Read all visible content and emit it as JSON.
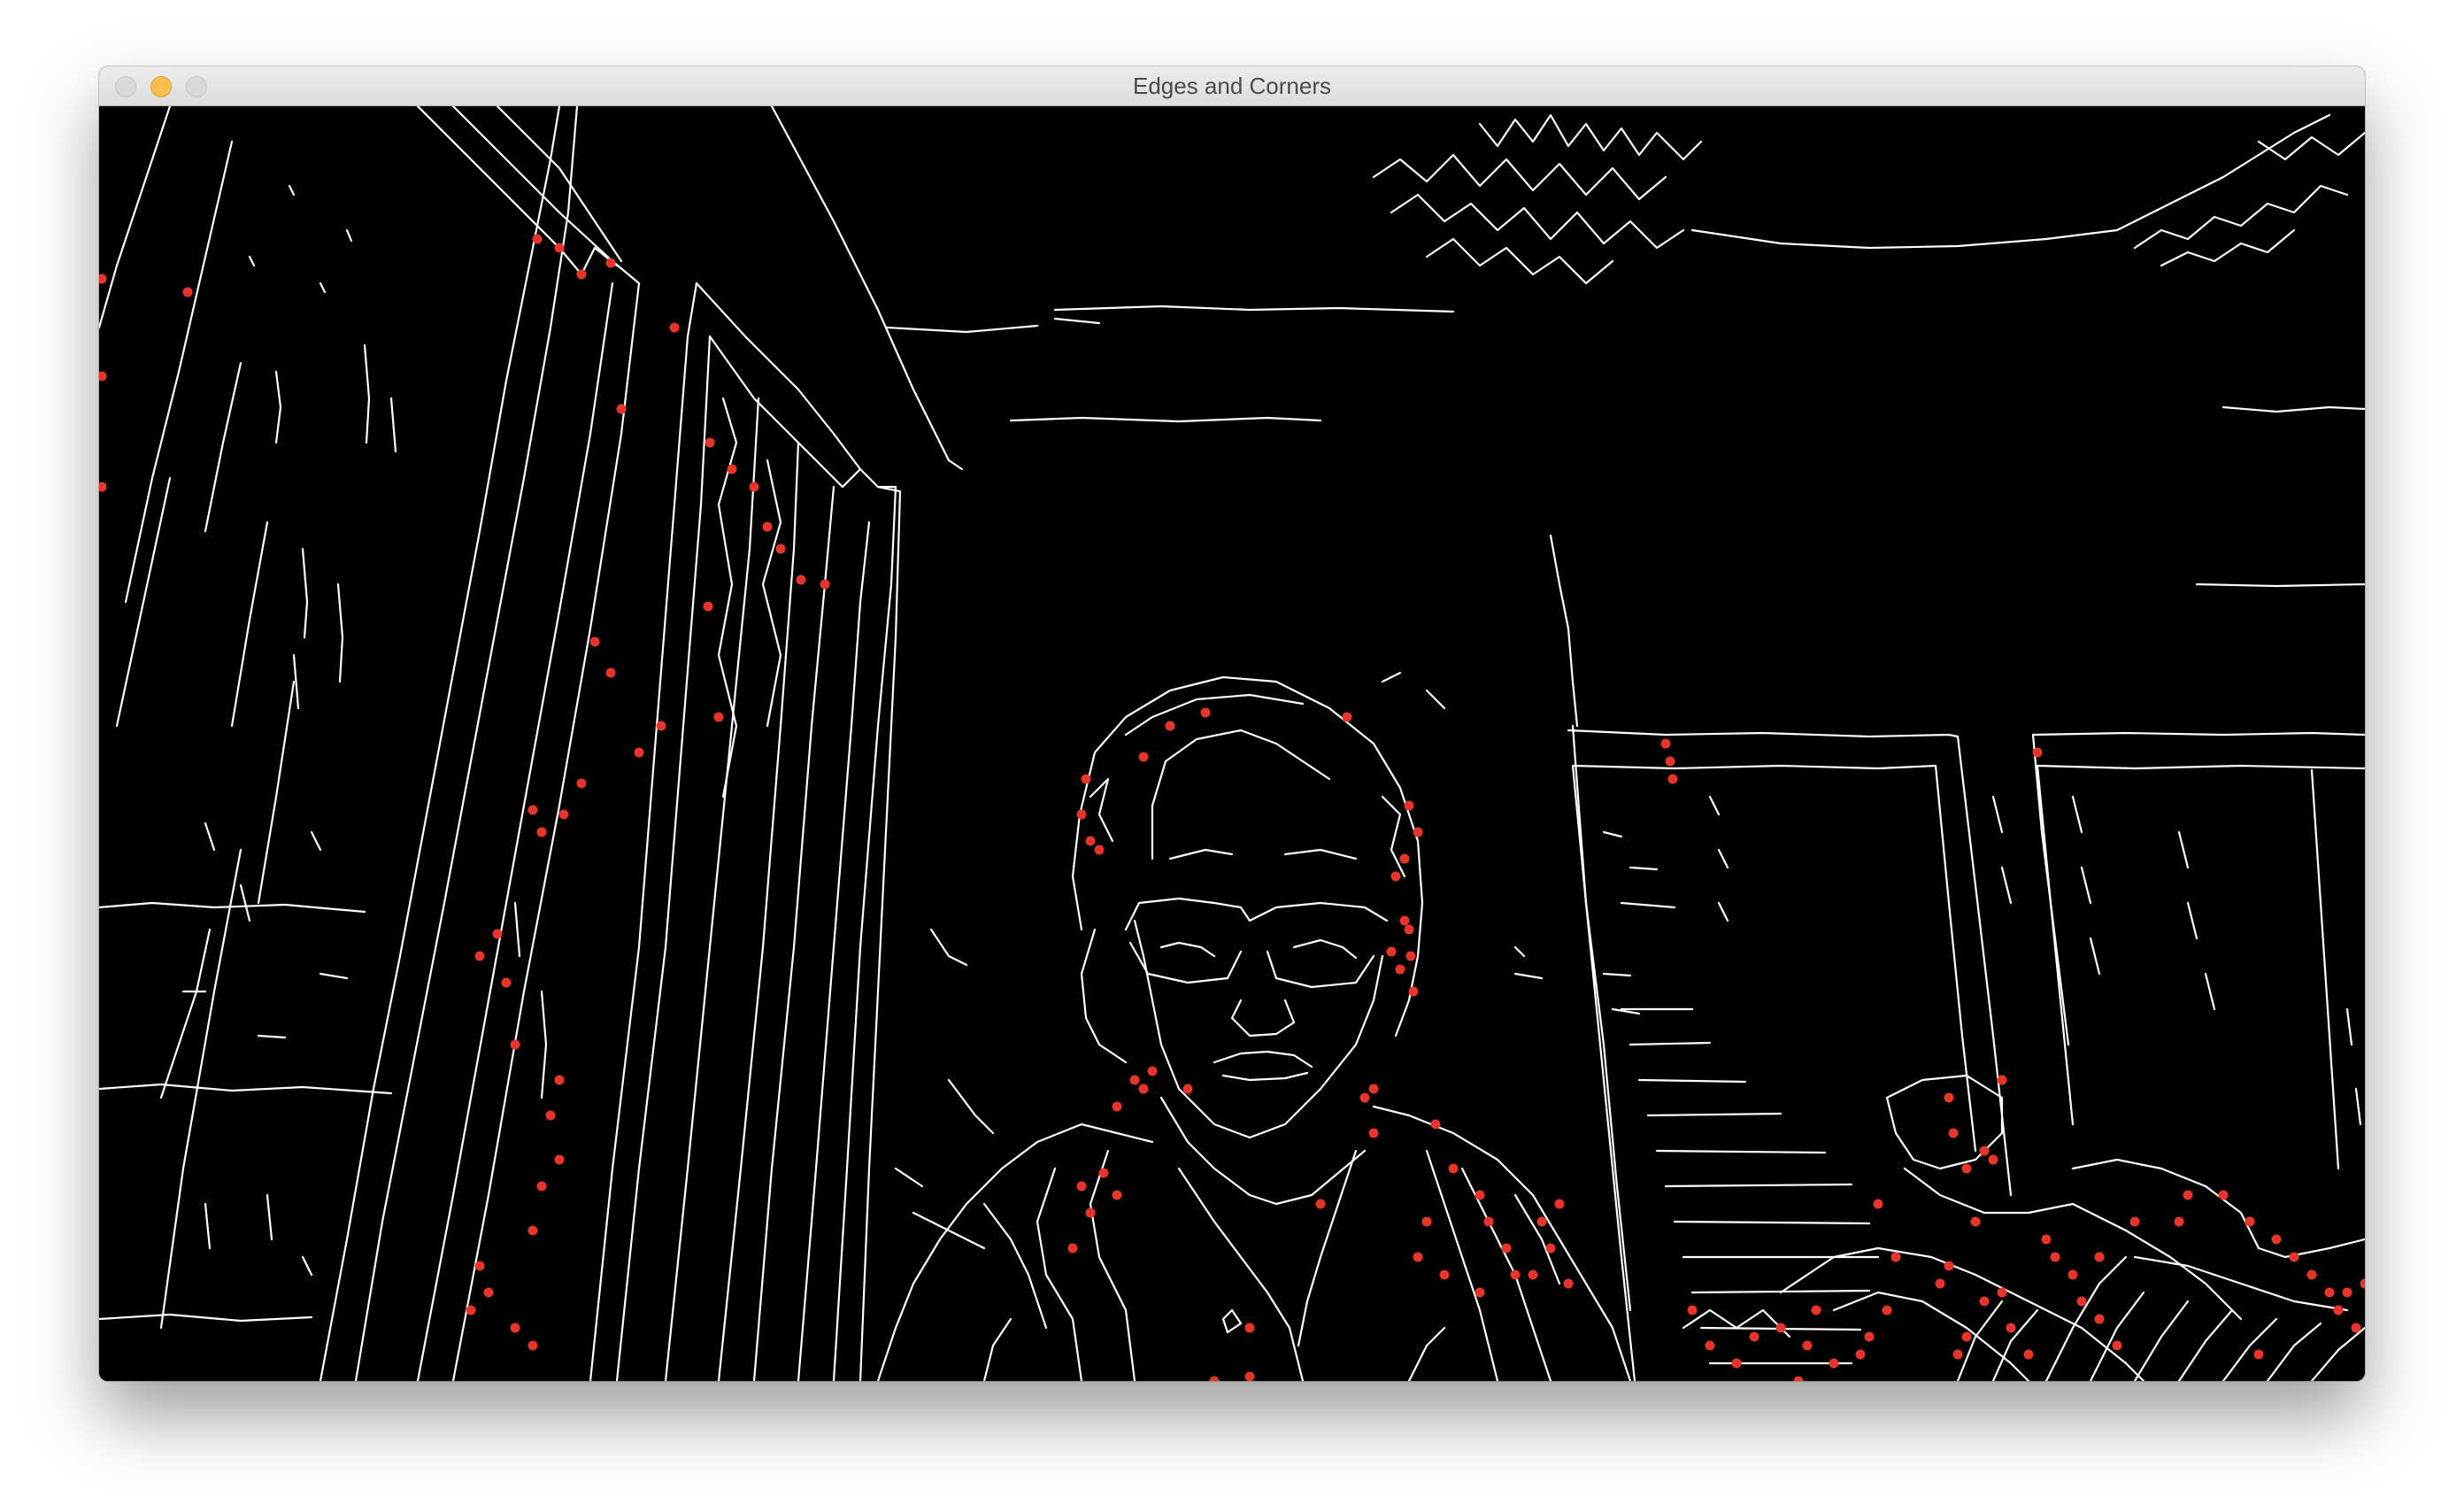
{
  "window": {
    "title": "Edges and Corners",
    "traffic_lights": [
      "close-button",
      "minimize-button",
      "zoom-button"
    ]
  },
  "canvas": {
    "background": "#000000",
    "edge_color": "#ffffff",
    "corner_color": "#e8352b"
  }
}
